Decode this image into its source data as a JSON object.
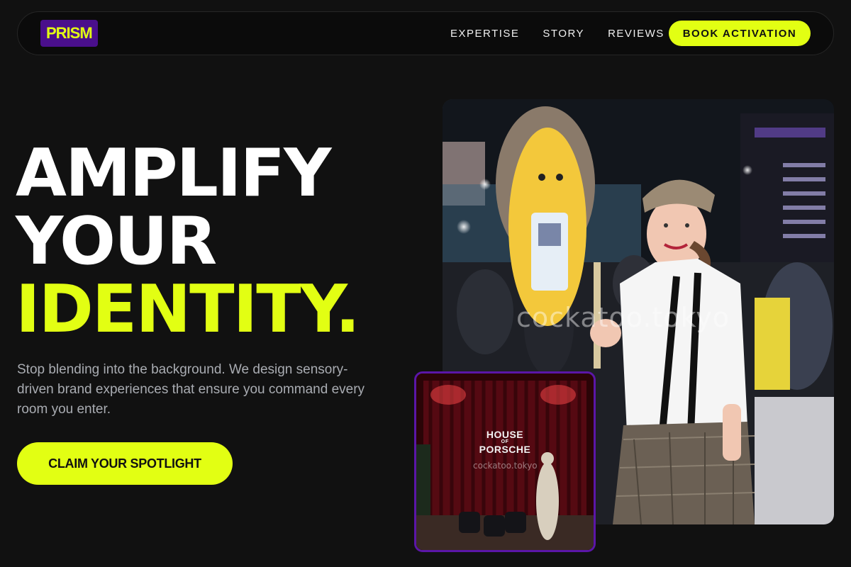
{
  "nav": {
    "logo": "PRISM",
    "links": [
      "EXPERTISE",
      "STORY",
      "REVIEWS"
    ],
    "cta": "BOOK ACTIVATION"
  },
  "hero": {
    "title_line1": "AMPLIFY",
    "title_line2": "YOUR",
    "title_line3": "IDENTITY.",
    "description": "Stop blending into the background. We design sensory-driven brand experiences that ensure you command every room you enter.",
    "cta": "CLAIM YOUR SPOTLIGHT"
  },
  "photos": {
    "main_watermark": "cockatoo.tokyo",
    "inset_sign_line1": "HOUSE",
    "inset_sign_line2": "OF",
    "inset_sign_line3": "PORSCHE",
    "inset_watermark": "cockatoo.tokyo"
  },
  "colors": {
    "background": "#111111",
    "accent": "#e2ff13",
    "brand_purple": "#4a0f8c",
    "muted_text": "#a9acb2"
  }
}
